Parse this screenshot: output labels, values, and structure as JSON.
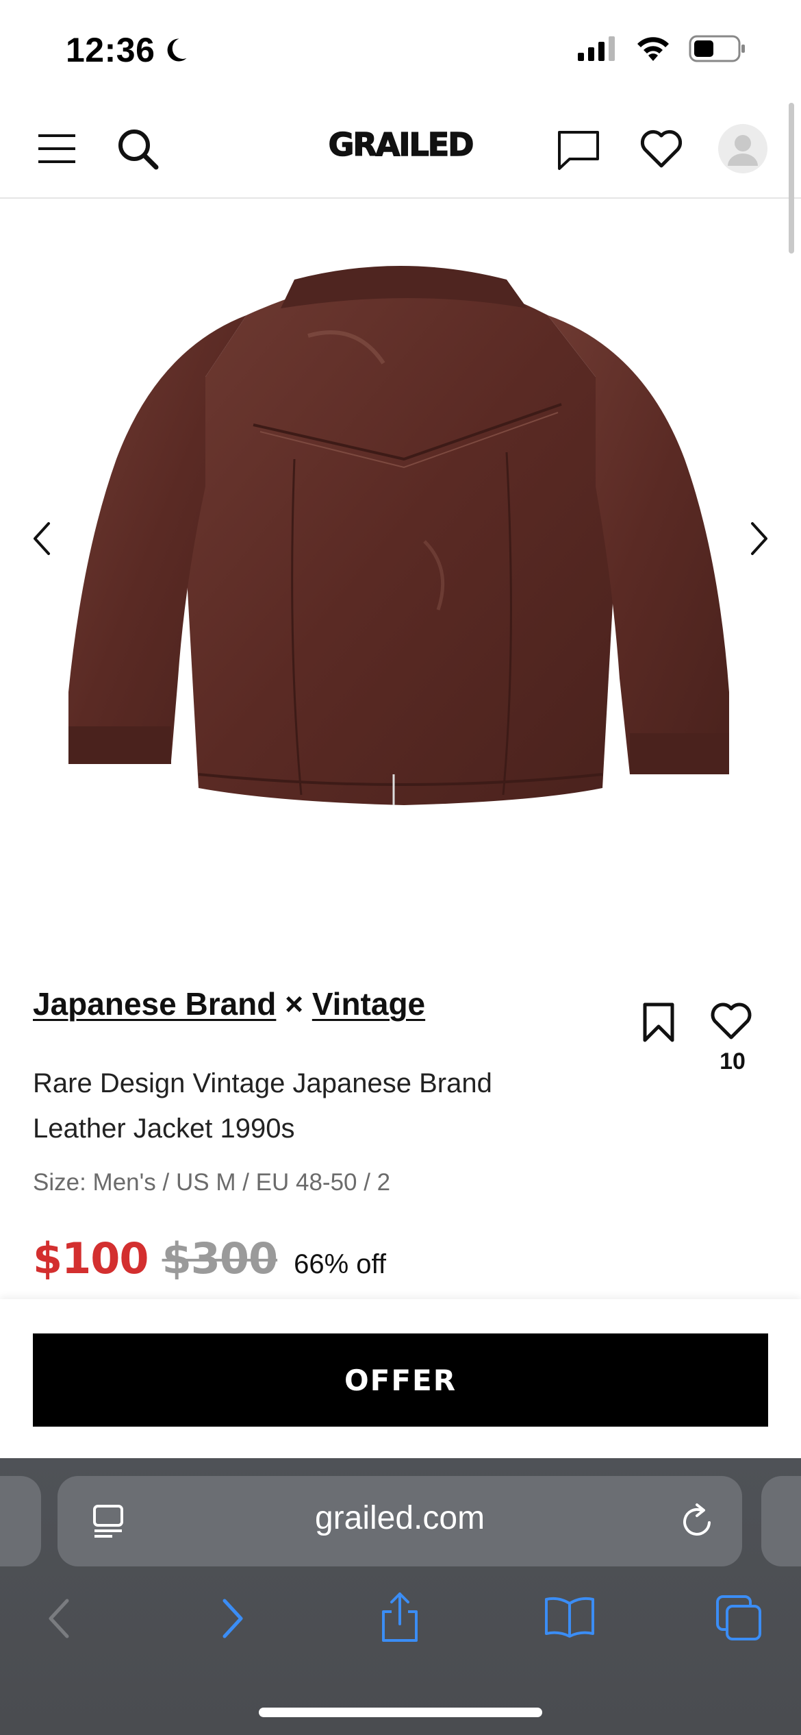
{
  "status_bar": {
    "time": "12:36",
    "icons": [
      "moon-icon",
      "cellular-signal-icon",
      "wifi-icon",
      "battery-icon"
    ]
  },
  "header": {
    "logo": "GRAILED",
    "icons": [
      "menu-icon",
      "search-icon",
      "messages-icon",
      "favorites-icon",
      "account-avatar-icon"
    ]
  },
  "product": {
    "brands": [
      "Japanese Brand",
      "Vintage"
    ],
    "brand_separator": "×",
    "title": "Rare Design Vintage Japanese Brand Leather Jacket 1990s",
    "size": "Size: Men's / US M / EU 48-50 / 2",
    "price": "$100",
    "original_price": "$300",
    "discount": "66% off",
    "favorite_count": "10",
    "image_description_icon": "leather-jacket-back-photo",
    "jacket_color": "#5a2a24"
  },
  "actions": {
    "offer_label": "OFFER"
  },
  "browser": {
    "url": "grailed.com",
    "toolbar_icons": [
      "back-icon",
      "forward-icon",
      "share-icon",
      "bookmarks-icon",
      "tabs-icon"
    ],
    "accent": "#3b8df5"
  }
}
